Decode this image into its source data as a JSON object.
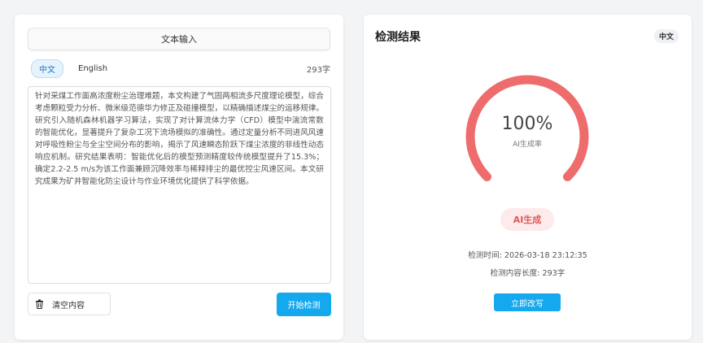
{
  "input_panel": {
    "mode_tab_label": "文本输入",
    "languages": [
      "中文",
      "English"
    ],
    "active_language": "中文",
    "char_count": "293字",
    "text": "针对采煤工作面高浓度粉尘治理难题，本文构建了气固两相流多尺度理论模型，综合考虑颗粒受力分析、微米级范德华力修正及碰撞模型，以精确描述煤尘的运移规律。研究引入随机森林机器学习算法，实现了对计算流体力学（CFD）模型中湍流常数的智能优化，显著提升了复杂工况下流场模拟的准确性。通过定量分析不同进风风速对呼吸性粉尘与全尘空间分布的影响，揭示了风速瞬态阶跃下煤尘浓度的非线性动态响应机制。研究结果表明：智能优化后的模型预测精度较传统模型提升了15.3%；确定2.2-2.5 m/s为该工作面兼顾沉降效率与稀释排尘的最优控尘风速区间。本文研究成果为矿井智能化防尘设计与作业环境优化提供了科学依据。",
    "clear_label": "清空内容",
    "start_label": "开始检测"
  },
  "result_panel": {
    "title": "检测结果",
    "language_badge": "中文",
    "gauge_value": "100%",
    "gauge_label": "AI生成率",
    "gauge_fraction": 1.0,
    "verdict": "AI生成",
    "detect_time": "检测时间: 2026-03-18 23:12:35",
    "content_length": "检测内容长度: 293字",
    "rewrite_label": "立即改写"
  },
  "colors": {
    "accent": "#14a8ee",
    "gauge": "#ef6c6c",
    "verdict_bg": "#fdeaea",
    "verdict_text": "#e25858"
  }
}
